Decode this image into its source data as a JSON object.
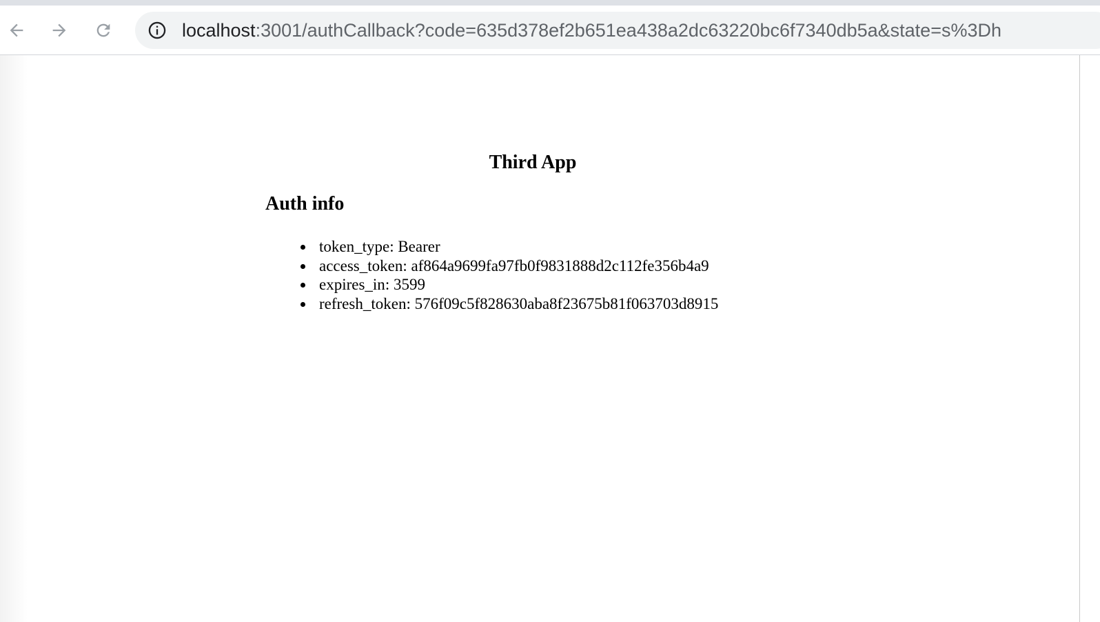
{
  "browser": {
    "url_host": "localhost",
    "url_rest": ":3001/authCallback?code=635d378ef2b651ea438a2dc63220bc6f7340db5a&state=s%3Dh",
    "icons": {
      "back": "arrow-left-icon",
      "forward": "arrow-right-icon",
      "reload": "reload-icon",
      "site_info": "info-icon"
    }
  },
  "page": {
    "title": "Third App",
    "section_title": "Auth info",
    "auth_items": [
      {
        "key": "token_type",
        "value": "Bearer"
      },
      {
        "key": "access_token",
        "value": "af864a9699fa97fb0f9831888d2c112fe356b4a9"
      },
      {
        "key": "expires_in",
        "value": "3599"
      },
      {
        "key": "refresh_token",
        "value": "576f09c5f828630aba8f23675b81f063703d8915"
      }
    ]
  }
}
